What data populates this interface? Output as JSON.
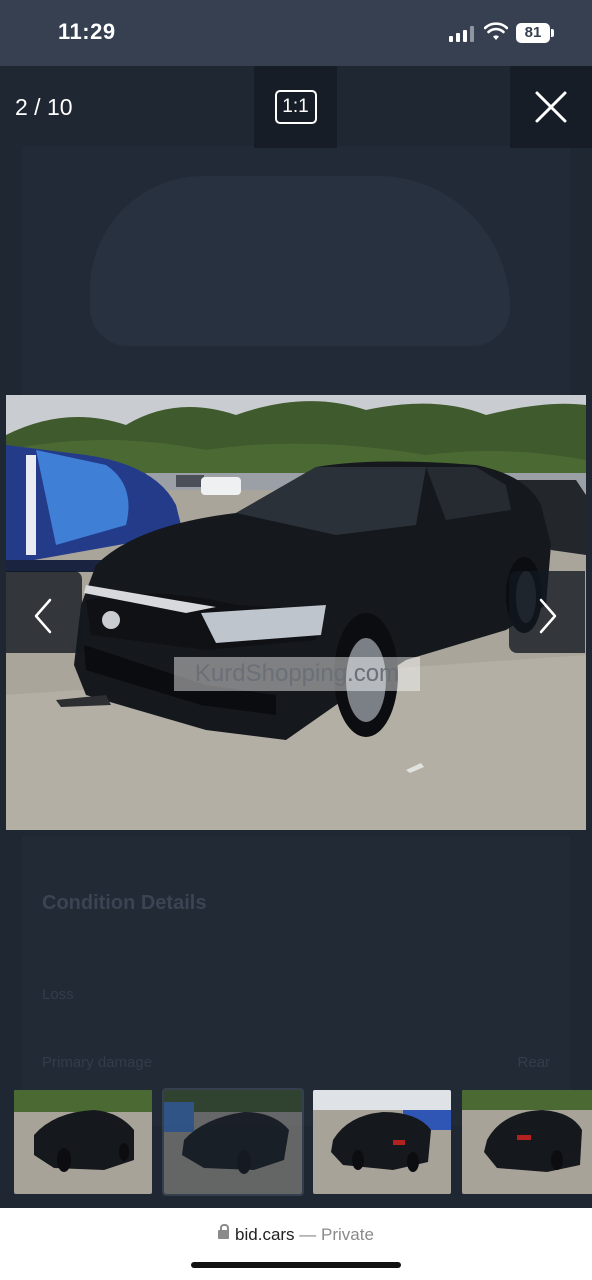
{
  "status_bar": {
    "time": "11:29",
    "battery": "81"
  },
  "viewer": {
    "counter": "2 / 10",
    "ratio_label": "1:1",
    "watermark": "KurdShopping.com",
    "background_panel": {
      "heading": "Condition Details",
      "row1_label": "Loss",
      "row2_label": "Primary damage",
      "row2_value": "Rear"
    }
  },
  "thumbnails": [
    {
      "label": "thumbnail-1",
      "active": false
    },
    {
      "label": "thumbnail-2",
      "active": true
    },
    {
      "label": "thumbnail-3",
      "active": false
    },
    {
      "label": "thumbnail-4",
      "active": false
    }
  ],
  "browser": {
    "domain": "bid.cars",
    "separator": "—",
    "mode": "Private"
  },
  "icons": [
    "signal-icon",
    "wifi-icon",
    "battery-icon",
    "close-icon",
    "chevron-left-icon",
    "chevron-right-icon",
    "lock-icon"
  ]
}
